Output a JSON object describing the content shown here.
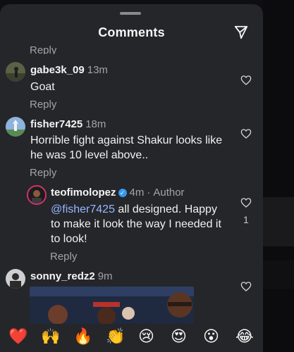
{
  "header": {
    "title": "Comments",
    "send_icon": "paper-plane-icon"
  },
  "top_reply_label": "Reply",
  "comments": [
    {
      "user": "gabe3k_09",
      "time": "13m",
      "text": "Goat",
      "reply_label": "Reply"
    },
    {
      "user": "fisher7425",
      "time": "18m",
      "text": "Horrible fight against Shakur looks like he was 10 level above..",
      "reply_label": "Reply"
    }
  ],
  "reply_comment": {
    "user": "teofimolopez",
    "time": "4m",
    "author_tag": "Author",
    "mention": "@fisher7425",
    "text": " all designed. Happy to make it look the way I needed it to look!",
    "likes": "1",
    "reply_label": "Reply"
  },
  "last_comment": {
    "user": "sonny_redz2",
    "time": "9m"
  },
  "emoji_bar": [
    "❤️",
    "🙌",
    "🔥",
    "👏",
    "😢",
    "😍",
    "😮",
    "😂"
  ],
  "colors": {
    "sheet_bg": "#25262a",
    "muted": "#a3a3a8",
    "mention": "#95b7ff",
    "verified": "#3797f0"
  }
}
